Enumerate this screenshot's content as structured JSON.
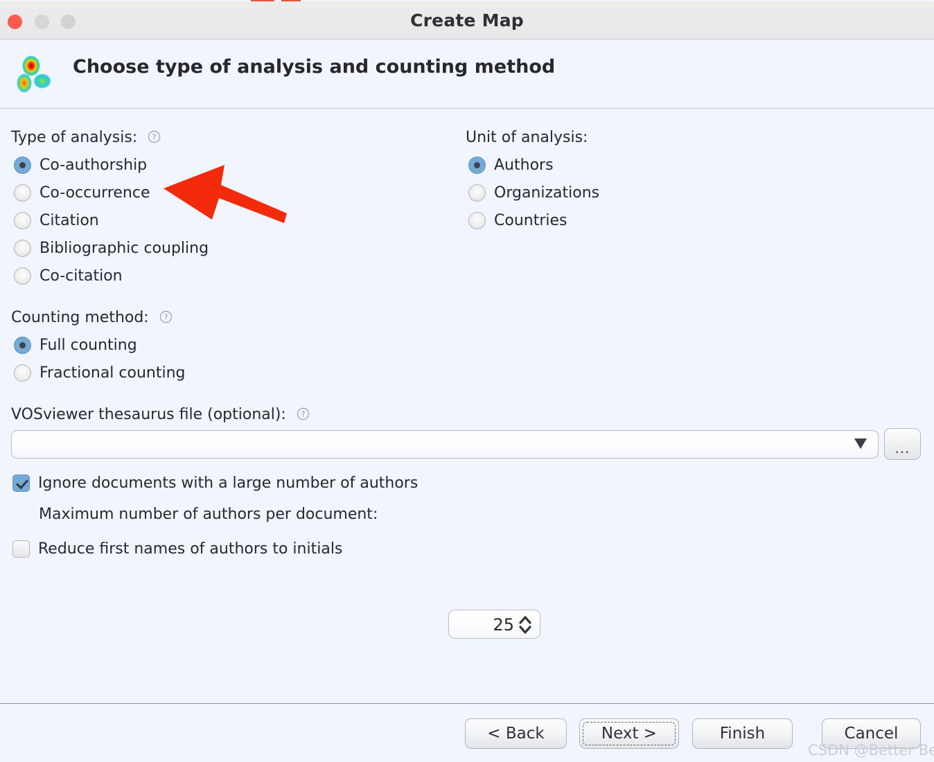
{
  "window": {
    "title": "Create Map",
    "controls": [
      "close",
      "minimize",
      "maximize"
    ]
  },
  "header": {
    "title": "Choose type of analysis and counting method",
    "logo_icon": "vosviewer-density-logo"
  },
  "type_of_analysis": {
    "label": "Type of analysis:",
    "help_icon": "help-icon",
    "selected": "Co-authorship",
    "options": [
      {
        "label": "Co-authorship",
        "selected": true
      },
      {
        "label": "Co-occurrence",
        "selected": false
      },
      {
        "label": "Citation",
        "selected": false
      },
      {
        "label": "Bibliographic coupling",
        "selected": false
      },
      {
        "label": "Co-citation",
        "selected": false
      }
    ]
  },
  "unit_of_analysis": {
    "label": "Unit of analysis:",
    "selected": "Authors",
    "options": [
      {
        "label": "Authors",
        "selected": true
      },
      {
        "label": "Organizations",
        "selected": false
      },
      {
        "label": "Countries",
        "selected": false
      }
    ]
  },
  "counting_method": {
    "label": "Counting method:",
    "help_icon": "help-icon",
    "selected": "Full counting",
    "options": [
      {
        "label": "Full counting",
        "selected": true
      },
      {
        "label": "Fractional counting",
        "selected": false
      }
    ]
  },
  "thesaurus": {
    "label": "VOSviewer thesaurus file (optional):",
    "help_icon": "help-icon",
    "value": "",
    "placeholder": "",
    "dropdown_icon": "chevron-down-icon",
    "browse_label": "..."
  },
  "options": {
    "ignore_large_docs": {
      "label": "Ignore documents with a large number of authors",
      "checked": true
    },
    "max_authors": {
      "label": "Maximum number of authors per document:",
      "value": "25"
    },
    "reduce_initials": {
      "label": "Reduce first names of authors to initials",
      "checked": false
    }
  },
  "footer": {
    "back_label": "< Back",
    "next_label": "Next >",
    "finish_label": "Finish",
    "cancel_label": "Cancel",
    "focused_button": "Next >"
  },
  "annotation": {
    "arrow_color": "#F32B0C",
    "arrow_points_to": "Co-authorship",
    "watermark": "CSDN @Better Bench"
  },
  "colors": {
    "dialog_background": "#f1f5fd",
    "titlebar_background": "#ececed",
    "accent_selected": "#74aad6",
    "close_button": "#ff5b4f",
    "annotation_red": "#F32B0C"
  }
}
